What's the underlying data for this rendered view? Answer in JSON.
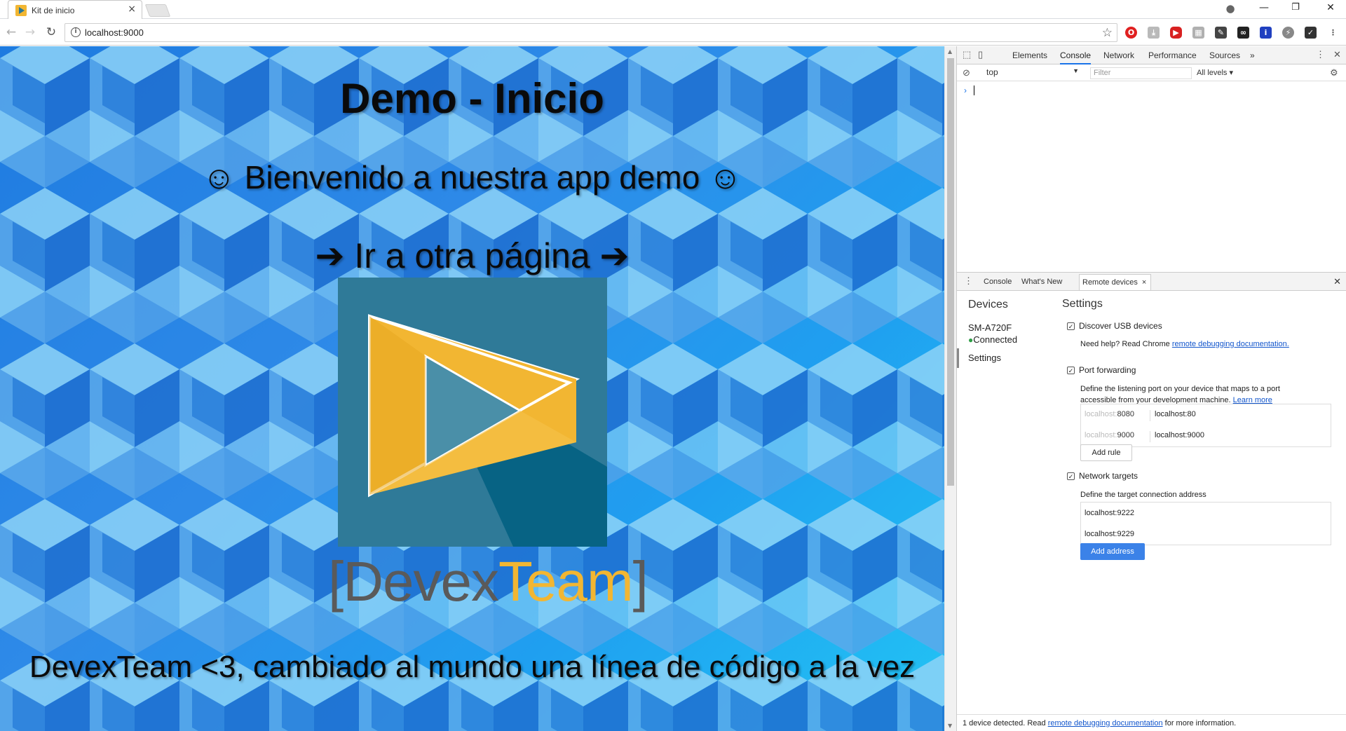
{
  "browser": {
    "tab_title": "Kit de inicio",
    "tab_close": "×",
    "url": "localhost:9000",
    "window_controls": {
      "minimize": "—",
      "restore": "❐",
      "close": "✕"
    }
  },
  "page": {
    "title": "Demo - Inicio",
    "welcome": "☺ Bienvenido a nuestra app demo ☺",
    "nav_link": "➔ Ir a otra página ➔",
    "brand": {
      "bracket_left": "[",
      "devex": "Devex",
      "team": "Team",
      "bracket_right": "]"
    },
    "footer": "DevexTeam <3, cambiado al mundo una línea de código a la vez"
  },
  "devtools": {
    "tabs": [
      "Elements",
      "Console",
      "Network",
      "Performance",
      "Sources"
    ],
    "more_tabs": "»",
    "console": {
      "context": "top",
      "filter_placeholder": "Filter",
      "levels": "All levels ▾",
      "prompt": "›"
    },
    "drawer": {
      "tabs": [
        "Console",
        "What's New",
        "Remote devices"
      ],
      "remote_close": "×",
      "close": "✕"
    },
    "remote_devices": {
      "devices_heading": "Devices",
      "device_name": "SM-A720F",
      "device_status": "Connected",
      "settings_nav": "Settings",
      "settings_heading": "Settings",
      "discover_usb": {
        "label": "Discover USB devices",
        "checked": true,
        "help_prefix": "Need help? Read Chrome ",
        "help_link": "remote debugging documentation."
      },
      "port_forwarding": {
        "label": "Port forwarding",
        "checked": true,
        "help": "Define the listening port on your device that maps to a port accessible from your development machine. ",
        "help_link": "Learn more",
        "rules": [
          {
            "port_prefix": "localhost:",
            "port": "8080",
            "address": "localhost:80"
          },
          {
            "port_prefix": "localhost:",
            "port": "9000",
            "address": "localhost:9000"
          }
        ],
        "add_rule": "Add rule"
      },
      "network_targets": {
        "label": "Network targets",
        "checked": true,
        "help": "Define the target connection address",
        "targets": [
          "localhost:9222",
          "localhost:9229"
        ],
        "add_address": "Add address"
      }
    },
    "status_bar": {
      "prefix": "1 device detected. Read ",
      "link": "remote debugging documentation",
      "suffix": " for more information."
    }
  },
  "colors": {
    "brand_yellow": "#f2b632",
    "brand_teal": "#2f7a98",
    "page_bg": "#1e7be0",
    "devtools_accent": "#1a73e8",
    "connected_dot": "#2e9e46"
  },
  "icons": [
    "info-icon",
    "star-icon",
    "reload-icon",
    "back-icon",
    "forward-icon",
    "profile-icon",
    "inspect-icon",
    "device-toolbar-icon",
    "clear-console-icon",
    "settings-gear-icon",
    "kebab-menu-icon",
    "close-icon"
  ]
}
